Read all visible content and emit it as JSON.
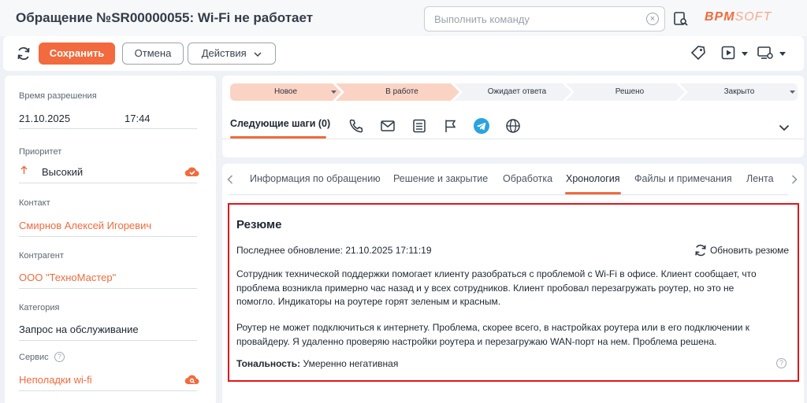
{
  "header": {
    "title": "Обращение №SR00000055: Wi-Fi не работает",
    "command_placeholder": "Выполнить команду",
    "logo_main": "BPM",
    "logo_thin": "SOFT"
  },
  "toolbar": {
    "save_label": "Сохранить",
    "cancel_label": "Отмена",
    "actions_label": "Действия"
  },
  "fields": {
    "resolution_time_label": "Время разрешения",
    "resolution_date": "21.10.2025",
    "resolution_time": "17:44",
    "priority_label": "Приоритет",
    "priority_value": "Высокий",
    "contact_label": "Контакт",
    "contact_value": "Смирнов Алексей Игоревич",
    "account_label": "Контрагент",
    "account_value": "ООО \"ТехноМастер\"",
    "category_label": "Категория",
    "category_value": "Запрос на обслуживание",
    "service_label": "Сервис",
    "service_value": "Неполадки wi-fi"
  },
  "stages": [
    "Новое",
    "В работе",
    "Ожидает ответа",
    "Решено",
    "Закрыто"
  ],
  "next_steps": {
    "title": "Следующие шаги (0)"
  },
  "tabs": [
    "Информация по обращению",
    "Решение и закрытие",
    "Обработка",
    "Хронология",
    "Файлы и примечания",
    "Лента"
  ],
  "summary": {
    "title": "Резюме",
    "last_update": "Последнее обновление: 21.10.2025 17:11:19",
    "refresh_label": "Обновить резюме",
    "paragraph1_line1": "Сотрудник технической поддержки помогает клиенту разобраться с проблемой с Wi-Fi в офисе. Клиент сообщает, что",
    "paragraph1_line2": "проблема возникла примерно час назад и у всех сотрудников. Клиент пробовал перезагружать роутер, но это не",
    "paragraph1_line3": "помогло. Индикаторы на роутере горят зеленым и красным.",
    "paragraph2_line1": "Роутер не может подключиться к интернету. Проблема, скорее всего, в настройках роутера или в его подключении к",
    "paragraph2_line2": "провайдеру. Я удаленно проверяю настройки роутера и перезагружаю WAN-порт на нем. Проблема решена.",
    "tone_label": "Тональность:",
    "tone_value": "Умеренно негативная"
  },
  "colors": {
    "accent": "#f26a3d",
    "highlight_border": "#e0161b",
    "stage_done": "#fbd3c4",
    "stage_todo": "#f1f3f6"
  }
}
